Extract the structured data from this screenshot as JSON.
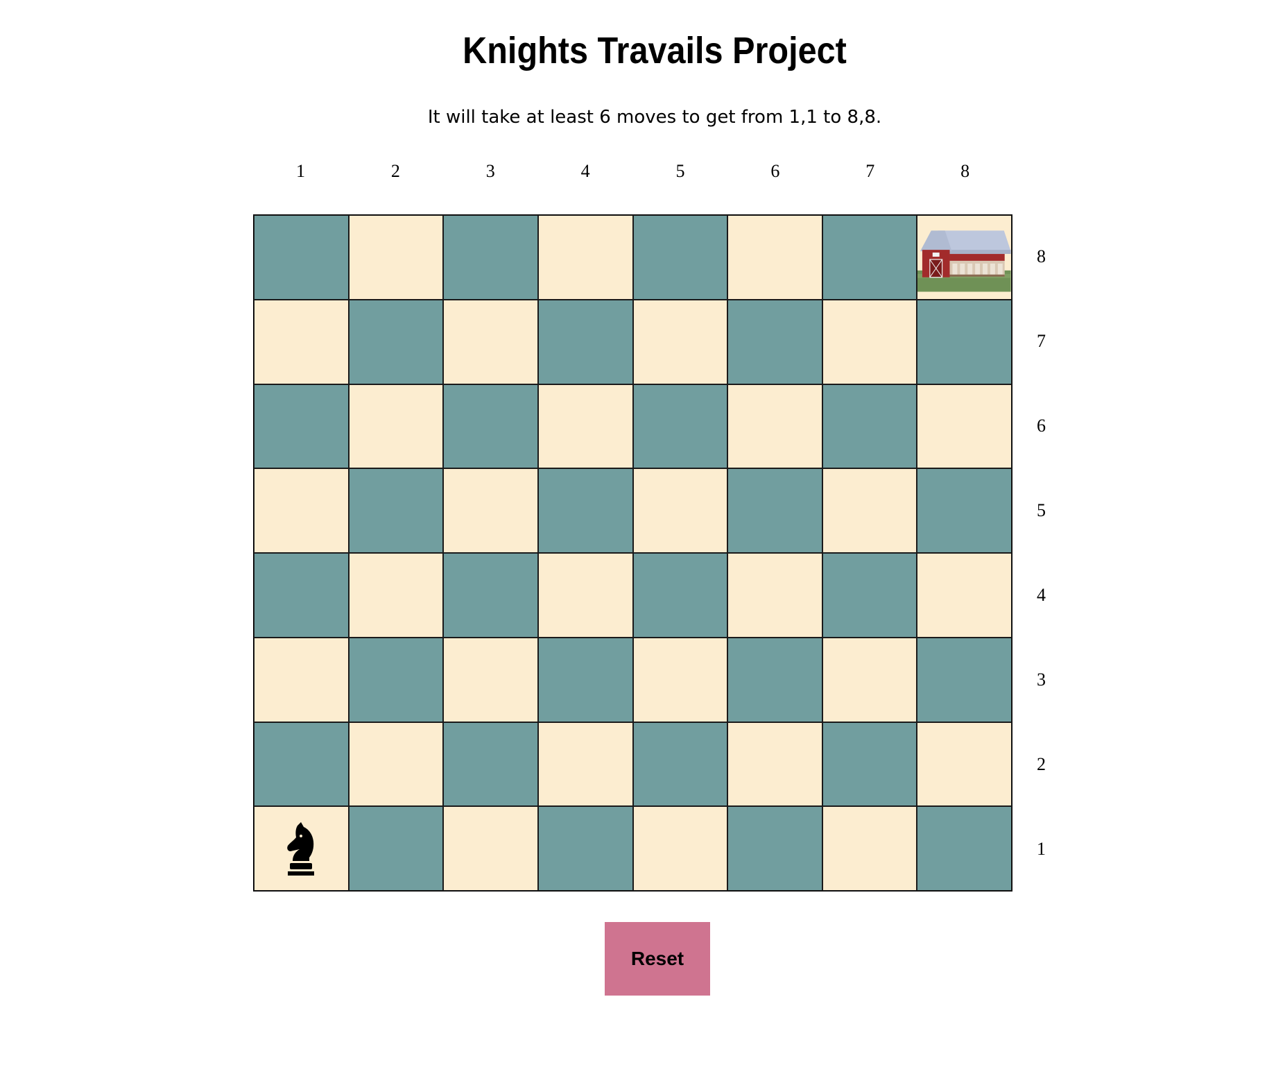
{
  "title": "Knights Travails Project",
  "message": "It will take at least 6 moves to get from 1,1 to 8,8.",
  "board": {
    "size": 8,
    "column_labels": [
      "1",
      "2",
      "3",
      "4",
      "5",
      "6",
      "7",
      "8"
    ],
    "row_labels": [
      "8",
      "7",
      "6",
      "5",
      "4",
      "3",
      "2",
      "1"
    ],
    "dark_color": "#719e9f",
    "light_color": "#fcedd0",
    "knight": {
      "column": 1,
      "row": 1,
      "icon": "knight-icon"
    },
    "target": {
      "column": 8,
      "row": 8,
      "icon": "barn-icon"
    }
  },
  "reset": {
    "label": "Reset",
    "color": "#cf7490"
  }
}
